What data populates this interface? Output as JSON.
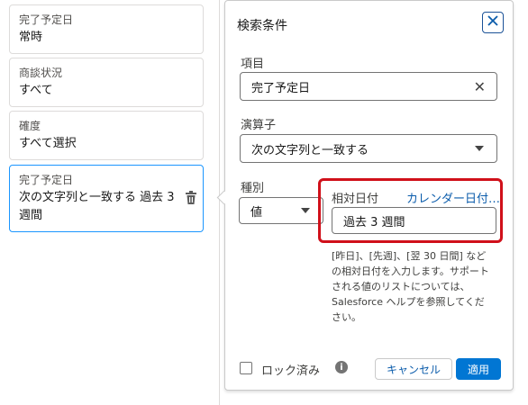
{
  "filters": [
    {
      "label": "完了予定日",
      "value": "常時"
    },
    {
      "label": "商談状況",
      "value": "すべて"
    },
    {
      "label": "確度",
      "value": "すべて選択"
    },
    {
      "label": "完了予定日",
      "value_line1": "次の文字列と一致する 過去 3",
      "value_line2": "週間"
    }
  ],
  "popover": {
    "title": "検索条件",
    "field_label": "項目",
    "field_value": "完了予定日",
    "operator_label": "演算子",
    "operator_value": "次の文字列と一致する",
    "type_label": "種別",
    "type_value": "値",
    "relative_date_tab": "相対日付",
    "calendar_date_tab": "カレンダー日付…",
    "relative_date_value": "過去 3 週間",
    "help_text": "[昨日]、[先週]、[翌 30 日間] などの相対日付を入力します。サポートされる値のリストについては、Salesforce ヘルプを参照してください。",
    "locked_label": "ロック済み",
    "info_icon": "i",
    "cancel_label": "キャンセル",
    "apply_label": "適用"
  },
  "colors": {
    "accent": "#0176d3",
    "highlight": "#d0101a"
  }
}
